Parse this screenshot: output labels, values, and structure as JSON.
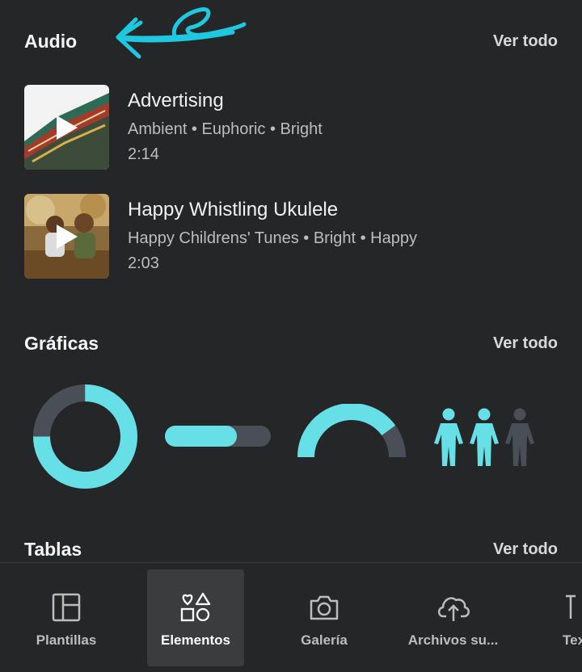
{
  "sections": {
    "audio": {
      "title": "Audio",
      "see_all": "Ver todo"
    },
    "graphics": {
      "title": "Gráficas",
      "see_all": "Ver todo"
    },
    "tables": {
      "title": "Tablas",
      "see_all": "Ver todo"
    }
  },
  "audio_tracks": [
    {
      "title": "Advertising",
      "tags": "Ambient • Euphoric • Bright",
      "duration": "2:14",
      "thumbnail": "pagoda-roof-photo"
    },
    {
      "title": "Happy Whistling Ukulele",
      "tags": "Happy Childrens' Tunes • Bright • Happy",
      "duration": "2:03",
      "thumbnail": "children-autumn-photo"
    }
  ],
  "graphics_items": [
    {
      "name": "donut-chart-graphic",
      "value": 0.75
    },
    {
      "name": "progress-bar-graphic",
      "value": 0.68
    },
    {
      "name": "gauge-graphic",
      "value": 0.8
    },
    {
      "name": "people-pictogram-graphic",
      "filled": 2,
      "total": 3
    }
  ],
  "colors": {
    "accent": "#66e0e6",
    "track": "#4a4f57",
    "background": "#252627",
    "annotation": "#1ec8e0"
  },
  "bottom_nav": [
    {
      "label": "Plantillas",
      "icon": "templates-icon",
      "active": false
    },
    {
      "label": "Elementos",
      "icon": "elements-icon",
      "active": true
    },
    {
      "label": "Galería",
      "icon": "camera-icon",
      "active": false
    },
    {
      "label": "Archivos su...",
      "icon": "cloud-upload-icon",
      "active": false
    },
    {
      "label": "Tex",
      "icon": "text-icon",
      "active": false
    }
  ]
}
